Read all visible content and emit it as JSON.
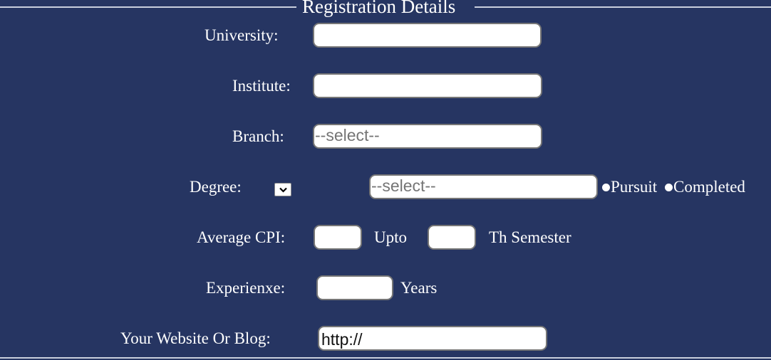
{
  "form": {
    "legend": "Registration Details",
    "university": {
      "label": "University:",
      "value": ""
    },
    "institute": {
      "label": "Institute:",
      "value": ""
    },
    "branch": {
      "label": "Branch:",
      "selected": "--select--"
    },
    "degree": {
      "label": "Degree:",
      "selected": "--select--",
      "status_options": [
        "Pursuit",
        "Completed"
      ]
    },
    "cpi": {
      "label": "Average CPI:",
      "cpi_value": "",
      "upto_label": "Upto",
      "semester_value": "",
      "semester_suffix": "Th Semester"
    },
    "experience": {
      "label": "Experienxe:",
      "value": "",
      "suffix": "Years"
    },
    "website": {
      "label": "Your Website Or Blog:",
      "value": "http://"
    }
  },
  "colors": {
    "background": "#263562",
    "text": "#ffffff",
    "field_background": "#ffffff",
    "field_border": "#767676",
    "placeholder": "#757575",
    "fieldset_border": "#c9cfdd"
  }
}
